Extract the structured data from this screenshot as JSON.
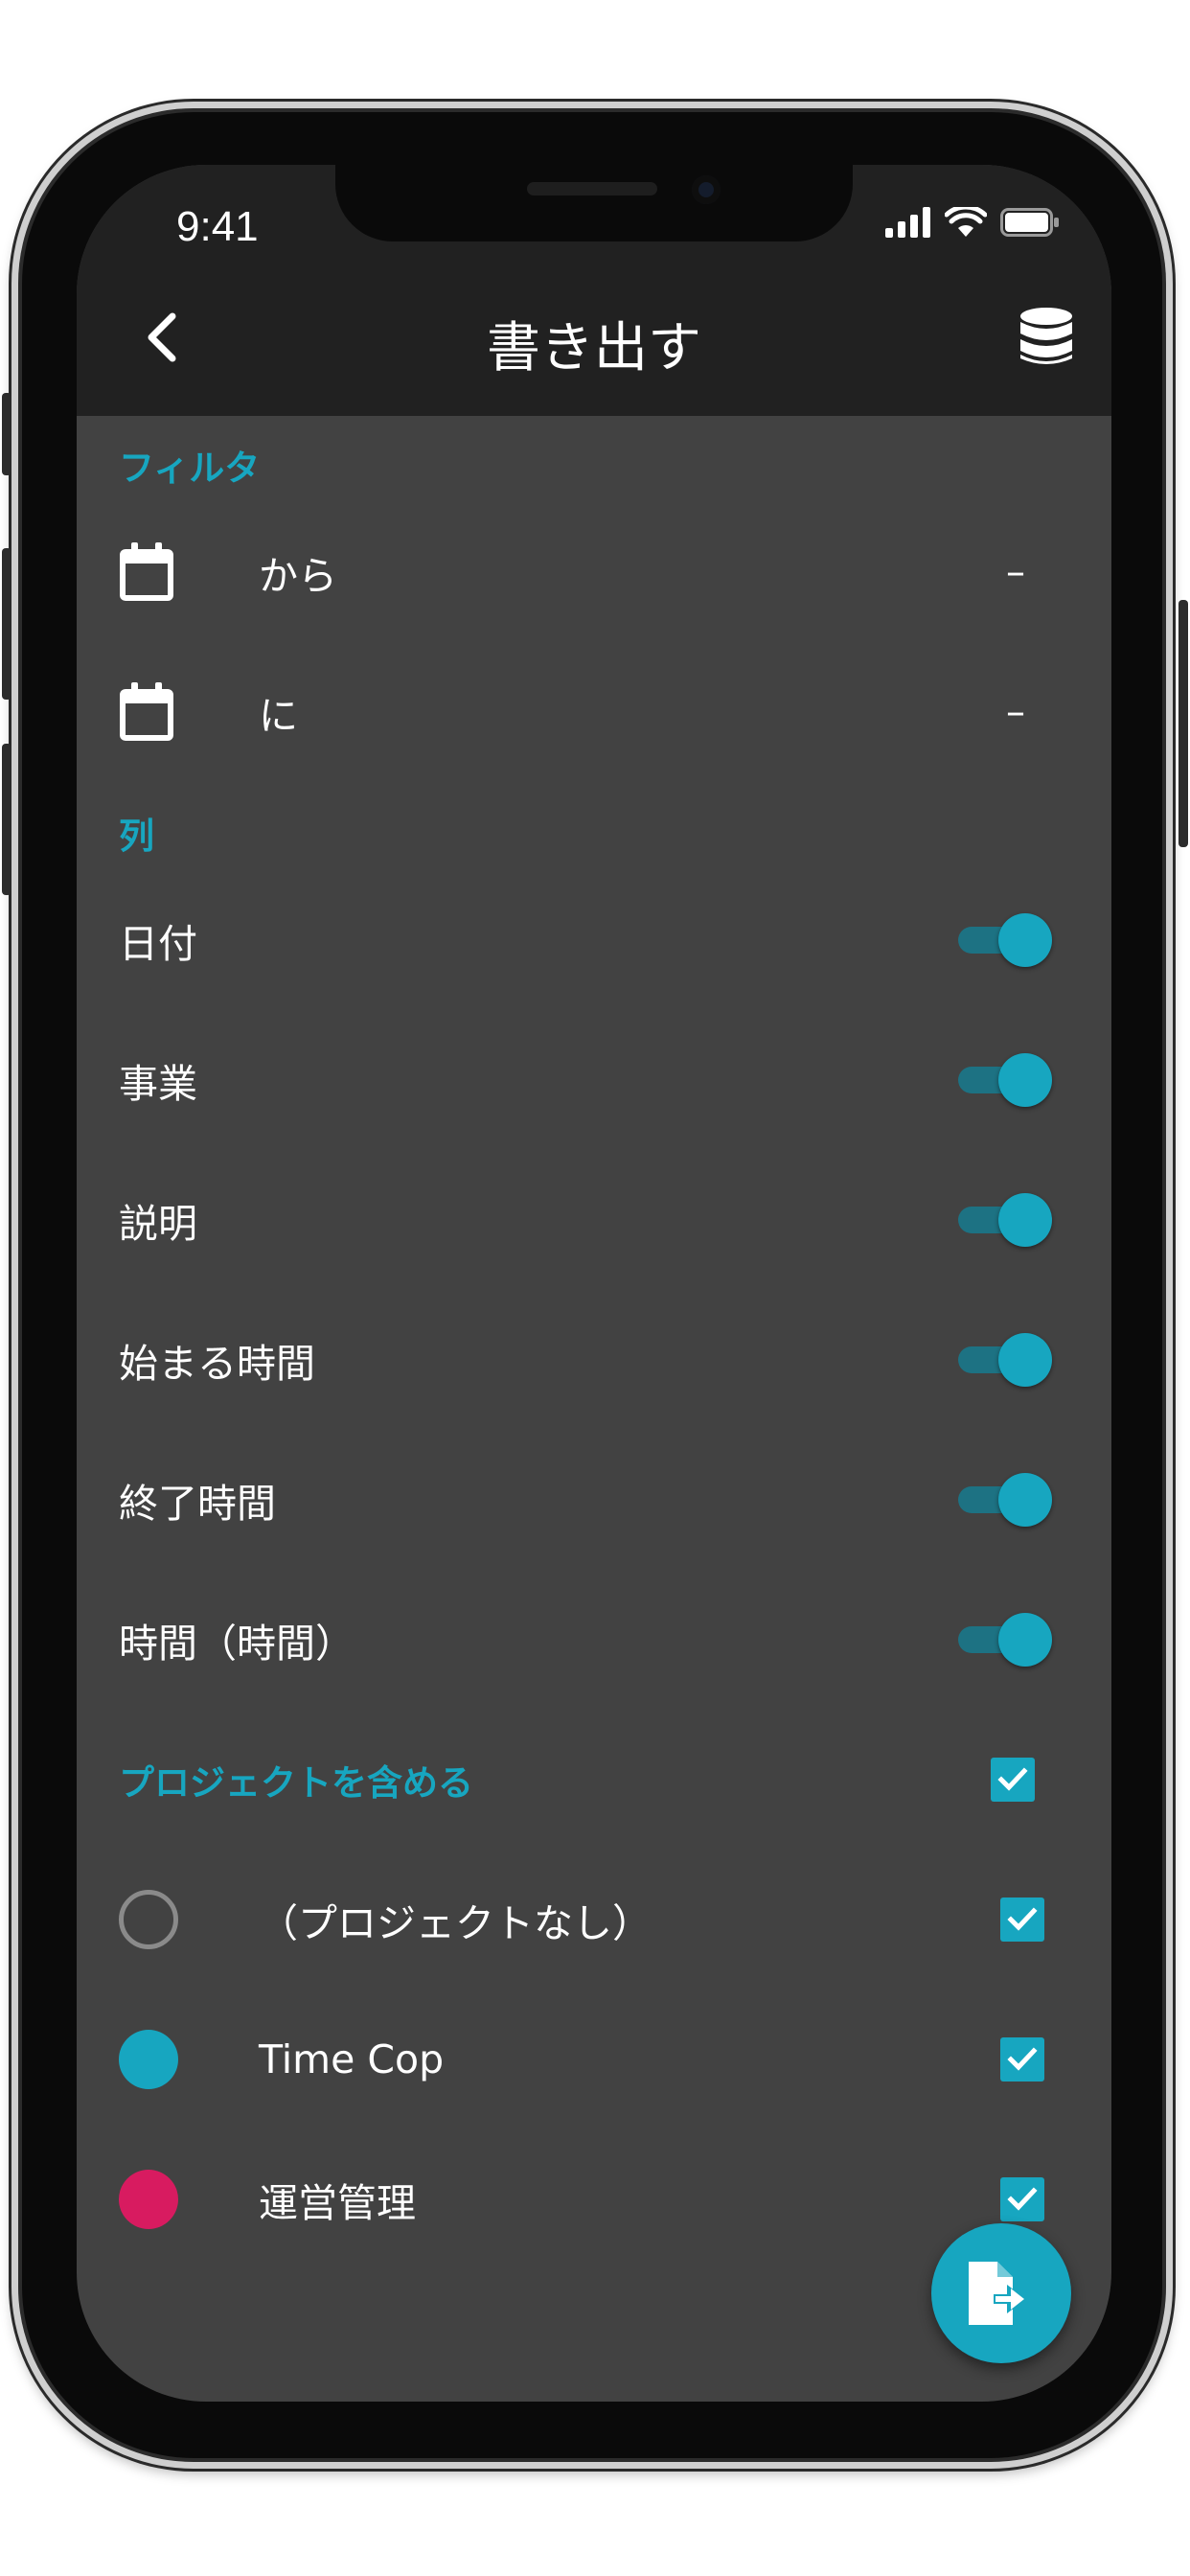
{
  "status_bar": {
    "time": "9:41"
  },
  "app_bar": {
    "title": "書き出す",
    "back_icon": "chevron-left-icon",
    "database_icon": "database-icon"
  },
  "filter_section": {
    "header": "フィルタ",
    "rows": [
      {
        "label": "から",
        "value": "–",
        "icon": "calendar-icon"
      },
      {
        "label": "に",
        "value": "–",
        "icon": "calendar-icon"
      }
    ]
  },
  "columns_section": {
    "header": "列",
    "items": [
      {
        "label": "日付",
        "enabled": true
      },
      {
        "label": "事業",
        "enabled": true
      },
      {
        "label": "説明",
        "enabled": true
      },
      {
        "label": "始まる時間",
        "enabled": true
      },
      {
        "label": "終了時間",
        "enabled": true
      },
      {
        "label": "時間（時間）",
        "enabled": true
      }
    ]
  },
  "projects_section": {
    "header": "プロジェクトを含める",
    "all_checked": true,
    "items": [
      {
        "label": "（プロジェクトなし）",
        "color": "none",
        "checked": true
      },
      {
        "label": "Time Cop",
        "color": "#17a6c0",
        "checked": true
      },
      {
        "label": "運営管理",
        "color": "#d81b60",
        "checked": true
      }
    ]
  },
  "fab": {
    "icon": "export-file-icon"
  },
  "colors": {
    "accent": "#17a6c0",
    "app_bar": "#212121",
    "background": "#424242",
    "toggle_track": "#1d7283"
  }
}
